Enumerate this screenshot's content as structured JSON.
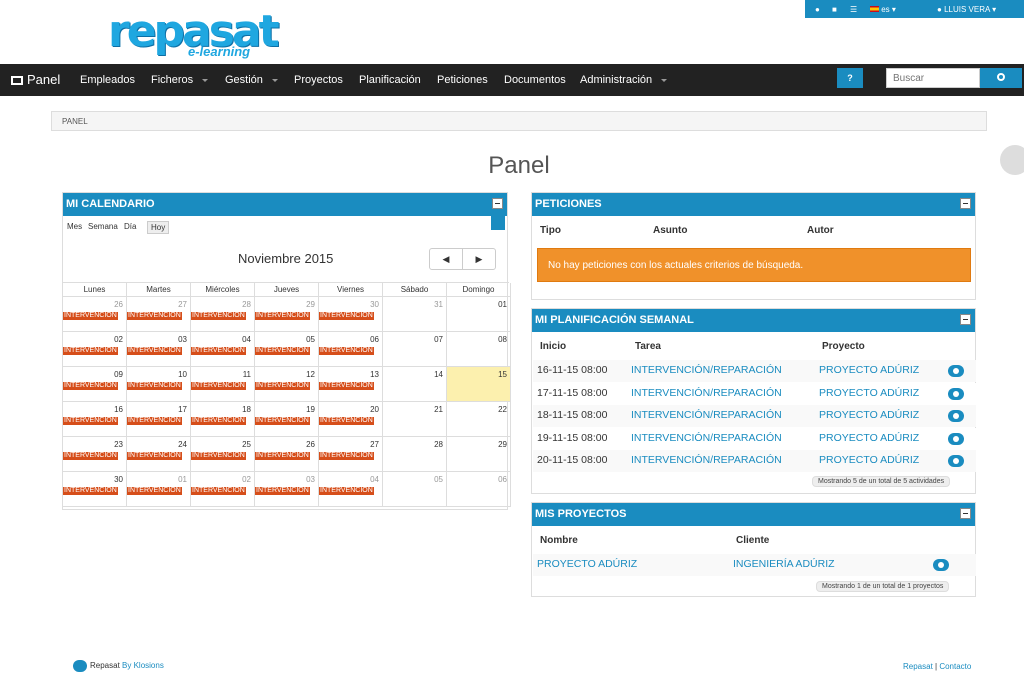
{
  "topbar": {
    "lang": "es",
    "user": "LLUIS VERA"
  },
  "logo": {
    "main": "repasat",
    "sub": "e-learning"
  },
  "nav": {
    "brand": "Panel",
    "items": [
      "Empleados",
      "Ficheros",
      "Gestión",
      "Proyectos",
      "Planificación",
      "Peticiones",
      "Documentos",
      "Administración"
    ],
    "help": "?",
    "search_placeholder": "Buscar"
  },
  "breadcrumb": "PANEL",
  "page_title": "Panel",
  "calendar": {
    "title": "MI CALENDARIO",
    "views": [
      "Mes",
      "Semana",
      "Día"
    ],
    "today_btn": "Hoy",
    "month": "Noviembre 2015",
    "weekdays": [
      "Lunes",
      "Martes",
      "Miércoles",
      "Jueves",
      "Viernes",
      "Sábado",
      "Domingo"
    ],
    "days": [
      "26",
      "27",
      "28",
      "29",
      "30",
      "31",
      "01",
      "02",
      "03",
      "04",
      "05",
      "06",
      "07",
      "08",
      "09",
      "10",
      "11",
      "12",
      "13",
      "14",
      "15",
      "16",
      "17",
      "18",
      "19",
      "20",
      "21",
      "22",
      "23",
      "24",
      "25",
      "26",
      "27",
      "28",
      "29",
      "30",
      "01",
      "02",
      "03",
      "04",
      "05",
      "06"
    ],
    "event_label": "INTERVENCIÓN"
  },
  "peticiones": {
    "title": "PETICIONES",
    "cols": [
      "Tipo",
      "Asunto",
      "Autor"
    ],
    "empty": "No hay peticiones con los actuales criterios de búsqueda."
  },
  "planificacion": {
    "title": "MI PLANIFICACIÓN SEMANAL",
    "cols": [
      "Inicio",
      "Tarea",
      "Proyecto"
    ],
    "rows": [
      {
        "inicio": "16-11-15 08:00",
        "tarea": "INTERVENCIÓN/REPARACIÓN",
        "proyecto": "PROYECTO ADÚRIZ"
      },
      {
        "inicio": "17-11-15 08:00",
        "tarea": "INTERVENCIÓN/REPARACIÓN",
        "proyecto": "PROYECTO ADÚRIZ"
      },
      {
        "inicio": "18-11-15 08:00",
        "tarea": "INTERVENCIÓN/REPARACIÓN",
        "proyecto": "PROYECTO ADÚRIZ"
      },
      {
        "inicio": "19-11-15 08:00",
        "tarea": "INTERVENCIÓN/REPARACIÓN",
        "proyecto": "PROYECTO ADÚRIZ"
      },
      {
        "inicio": "20-11-15 08:00",
        "tarea": "INTERVENCIÓN/REPARACIÓN",
        "proyecto": "PROYECTO ADÚRIZ"
      }
    ],
    "count": "Mostrando 5 de un total de 5 actividades"
  },
  "proyectos": {
    "title": "MIS PROYECTOS",
    "cols": [
      "Nombre",
      "Cliente"
    ],
    "rows": [
      {
        "nombre": "PROYECTO ADÚRIZ",
        "cliente": "INGENIERÍA ADÚRIZ"
      }
    ],
    "count": "Mostrando 1 de un total de 1 proyectos"
  },
  "footer": {
    "brand": "Repasat",
    "by": "By Klosions",
    "links": [
      "Repasat",
      "Contacto"
    ]
  },
  "colors": {
    "accent": "#1a8cc0",
    "event": "#d64e1a",
    "warning": "#f0912a",
    "today": "#fcf0ae"
  }
}
